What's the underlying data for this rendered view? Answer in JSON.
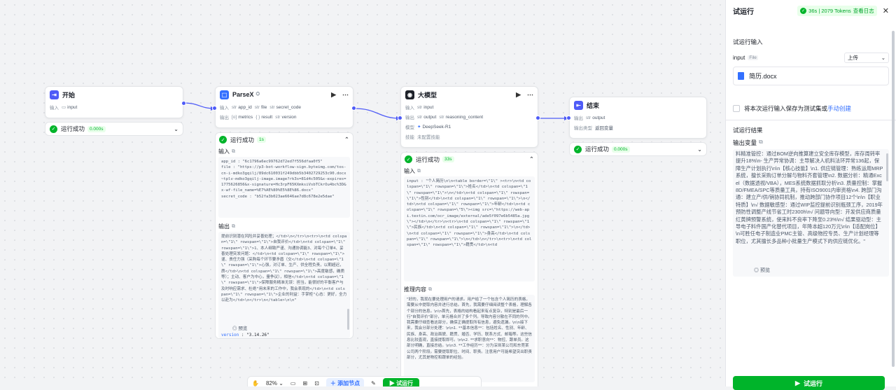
{
  "canvas": {
    "start": {
      "title": "开始",
      "in_label": "输入",
      "in_tag": "input",
      "run": "运行成功",
      "time": "0.000s"
    },
    "parsex": {
      "title": "ParseX",
      "in_label": "输入",
      "in_tags": [
        "app_id",
        "file",
        "secret_code"
      ],
      "out_label": "输出",
      "out_tags": [
        "metrics",
        "result",
        "version"
      ],
      "run": "运行成功",
      "time": "1s",
      "in_sec": "输入",
      "out_sec": "输出",
      "in_text": "app_id : \"6c1796a6ec99762d72ed7f556dfaa0f5\"\nfile : \"https://p3-bot-workflow-sign.byteimg.com/tos-cn-i-mdko3gqilj/89dc610031f249dbb5b3402729253c90.docx~tplv-mdko3gqilj-image.image?rk3s=81d4c505&x-expires=1775626856&x-signature=Hc3rpF65KXmksiVsbTCkrOu4bc%3D&x-wf-file_name=%E7%AE%80%E5%8E%86.docx\"\nsecret_code : \"b52fa3b023ae6646ae7d8c678e2e5dae\"",
      "out_text": "提前识别潜在风险并妥善处理；</td>\\n</tr>\\n<tr>\\n<td colspan=\\\"1\\\" rowspan=\\\"1\\\">自我评价</td>\\n<td colspan=\\\"1\\\" rowspan=\\\"1\\\">1、本人细致严谨、沟通协调能3、对每个订单4、妥善处理突发问题：</td>\\n<td colspan=\\\"1\\\" rowspan=\\\"1\\\">谨、责任力强（采购每个环节要矛盾（交</td>\\n<td colspan=\\\"1\\\" rowspan=\\\"1\\\">心强，对订单、生产、供全程负责，以期超迟，质</td>\\n<td colspan=\\\"1\\\" rowspan=\\\"1\\\">高度敏感，确质等）；主动、客户为中心，量争议），相信</td>\\n<td colspan=\\\"1\\\" rowspan=\\\"1\\\">保障服务精准无误：担当，能很好的平衡客户与及时响应需求、杜绝\"用未来的工作中，我会表现的</td>\\n<td colspan=\\\"1\\\" rowspan=\\\"1\\\">企业的利益：手掌柜\"心态：更好，全力以赴为</td>\\n</tr>\\n</table>\\n\\n\"",
      "preview": "预览",
      "version_key": "version",
      "version_val": "\"3.14.26\""
    },
    "llm": {
      "title": "大模型",
      "in_label": "输入",
      "in_tag": "input",
      "out_label": "输出",
      "out_tags": [
        "output",
        "reasoning_content"
      ],
      "model_label": "模型",
      "model": "DeepSeek-R1",
      "skill_label": "技能",
      "skill": "未配置技能",
      "run": "运行成功",
      "time": "33s",
      "in_sec": "输入",
      "reason_sec": "推理内容",
      "in_text": "input : \"个人简历\\n\\n<table border=\\\"1\\\" ><tr>\\n<td colspan=\\\"1\\\" rowspan=\\\"1\\\">姓名</td>\\n<td colspan=\\\"1\\\" rowspan=\\\"1\\\">\\n</td>\\n<td colspan=\\\"1\\\" rowspan=\\\"1\\\">性别</td>\\n<td colspan=\\\"1\\\" rowspan=\\\"1\\\">\\n</td>\\n<td colspan=\\\"1\\\" rowspan=\\\"1\\\">年龄</td>\\n<td colspan=\\\"1\\\" rowspan=\\\"5\\\"><img src=\\\"https://web-api.textin.com/ocr_image/external/ade5f097e6b5485a.jpg\\\"></td>\\n</tr>\\n<tr>\\n<td colspan=\\\"1\\\" rowspan=\\\"1\\\">民族</td>\\n<td colspan=\\\"1\\\" rowspan=\\\"1\\\">\\n</td>\\n<td colspan=\\\"1\\\" rowspan=\\\"1\\\">身高</td>\\n<td colspan=\\\"1\\\" rowspan=\\\"1\\\">\\n</td>\\n</tr>\\n<tr>\\n<td colspan=\\\"1\\\" rowspan=\\\"1\\\">籍贯</td>\\n<td",
      "reason_text": "\"好的，我现在要处理用户的请求。用户给了一个包含个人简历的表格，需要从中提取内容并进行总结。首先，我需要仔细阅读整个表格，理解各个部分的信息。\\n\\n首先，表格的结构看起来有点复杂，特别是最后一行\"自我评价\"部分，单元格合并了多个列。导致内容分散在不同的列中。我需要仔细查看这部分，确保正确提取所有信息，避免遗漏。\\n\\n接下来，我会分部分处理：\\n\\n1. **基本信息**：包括姓名、性别、年龄、民族、身高、政治面貌、籍贯、婚否、学历、联系方式、邮箱等。这些信息比较直观，直接提取即可。\\n\\n2. **求职意向**：物控、跟单员。这部分明确，直接总结。\\n\\n3. **工作经历**：分为深圳某公司和东莞某公司两个阶段。需要提取职位、时间、职责。注意用户可能希望突出职责部分，尤其是物控和跟单的经验。"
    },
    "end": {
      "title": "结束",
      "out_label": "输出",
      "out_tag": "output",
      "type_label": "输出类型",
      "type": "返回变量",
      "run": "运行成功",
      "time": "0.000s"
    }
  },
  "toolbar": {
    "zoom": "82%",
    "add_node": "添加节点",
    "try_run": "试运行"
  },
  "right": {
    "title": "试运行",
    "status": "36s | 2079 Tokens",
    "log": "查看日志",
    "input_section": "试运行输入",
    "input_label": "input",
    "input_type": "File",
    "upload": "上传",
    "file_name": "简历.docx",
    "save_text": "将本次运行输入保存为测试集或",
    "save_link": "手动创建",
    "result_section": "试运行结果",
    "output_var": "输出变量",
    "result_text": "料精准管控：通过BOM逆向推算建立安全库存模型，库存周转率提升18%\\n- 生产异常协调：主导解决人机料法环异常136起，保障生产计划执行\\n\\n【核心技能】\\n1. 供应链管理：熟练运用MRP系统，擅长采购订单分解与物料齐套管理\\n2. 数据分析：精通Excel（数据透视/VBA），MES系统数据抓取分析\\n3. 质量控制：掌握8D/FMEA/SPC等质量工具，持有ISO9001内审资格\\n4. 跨部门沟通：建立产/供/销协同机制，推动跨部门协作项目12个\\n\\n【职业特质】\\n√ 数据敏感型：通过WIP监控提前识别瓶颈工序，2019年预防性调整产线节省工时2300h\\n√ 问题导向型：开发供应商质量红黄牌预警系统，使来料不良率下降至0.23%\\n√ 结果驱动型：主导电子料件国产化替代项目，年降本超120万元\\n\\n【适配岗位】\\n可胜任电子制造业PMC主管、高级物控专员、生产计划经理等职位，尤其擅长多品种小批量生产模式下的供应链优化。\"",
    "preview": "预览",
    "try_btn": "试运行"
  },
  "colors": {
    "accent": "#4e5bf7",
    "success": "#00b42a",
    "bg": "#f2f3f5"
  }
}
